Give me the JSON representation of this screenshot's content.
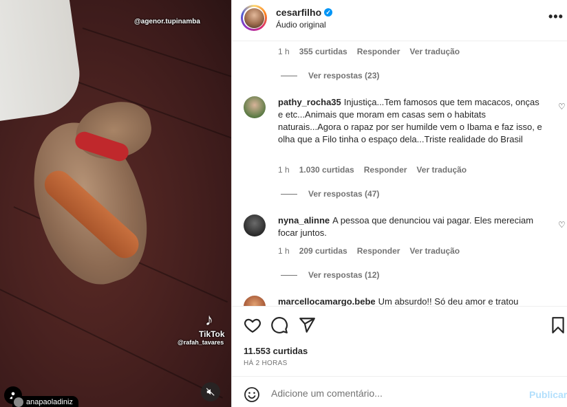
{
  "media": {
    "watermark_top": "@agenor.tupinamba",
    "tiktok_label": "TikTok",
    "tiktok_user": "@rafah_tavares",
    "tagged_user": "anapaoladiniz"
  },
  "header": {
    "username": "cesarfilho",
    "audio": "Áudio original",
    "more_label": "•••"
  },
  "comments": {
    "first_meta": {
      "time": "1 h",
      "likes": "355 curtidas",
      "reply": "Responder",
      "translate": "Ver tradução"
    },
    "first_replies": "Ver respostas (23)",
    "items": [
      {
        "username": "pathy_rocha35",
        "text": "Injustiça...Tem famosos que tem macacos, onças e etc...Animais que moram em casas sem o habitats naturais...Agora o rapaz por ser humilde vem o Ibama e faz isso, e olha que a Filo tinha o espaço dela...Triste realidade do Brasil",
        "time": "1 h",
        "likes": "1.030 curtidas",
        "reply": "Responder",
        "translate": "Ver tradução",
        "replies": "Ver respostas (47)"
      },
      {
        "username": "nyna_alinne",
        "text": "A pessoa que denunciou vai pagar. Eles mereciam focar juntos.",
        "time": "1 h",
        "likes": "209 curtidas",
        "reply": "Responder",
        "translate": "Ver tradução",
        "replies": "Ver respostas (12)"
      },
      {
        "username": "marcellocamargo.bebe",
        "text": "Um absurdo!! Só deu amor e tratou"
      }
    ]
  },
  "actions": {
    "likes": "11.553 curtidas",
    "time": "HÁ 2 HORAS"
  },
  "add_comment": {
    "placeholder": "Adicione um comentário...",
    "publish": "Publicar"
  },
  "colors": {
    "accent": "#0095f6",
    "publish_disabled": "#b2dffc",
    "secondary_text": "#737373"
  }
}
